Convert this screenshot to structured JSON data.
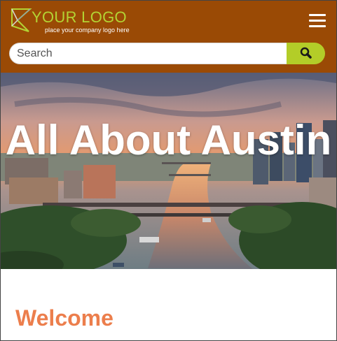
{
  "header": {
    "logo_text": "YOUR LOGO",
    "logo_tagline": "place your company logo here",
    "menu_icon": "hamburger-menu-icon"
  },
  "search": {
    "placeholder": "Search",
    "button_icon": "search-icon"
  },
  "hero": {
    "title": "All About Austin",
    "image_description_icon": "austin-skyline-photo"
  },
  "main": {
    "heading": "Welcome"
  },
  "colors": {
    "header_bg": "#9a4a05",
    "logo_accent": "#b3d334",
    "search_button": "#b3cd28",
    "welcome_heading": "#ec7e4c"
  }
}
